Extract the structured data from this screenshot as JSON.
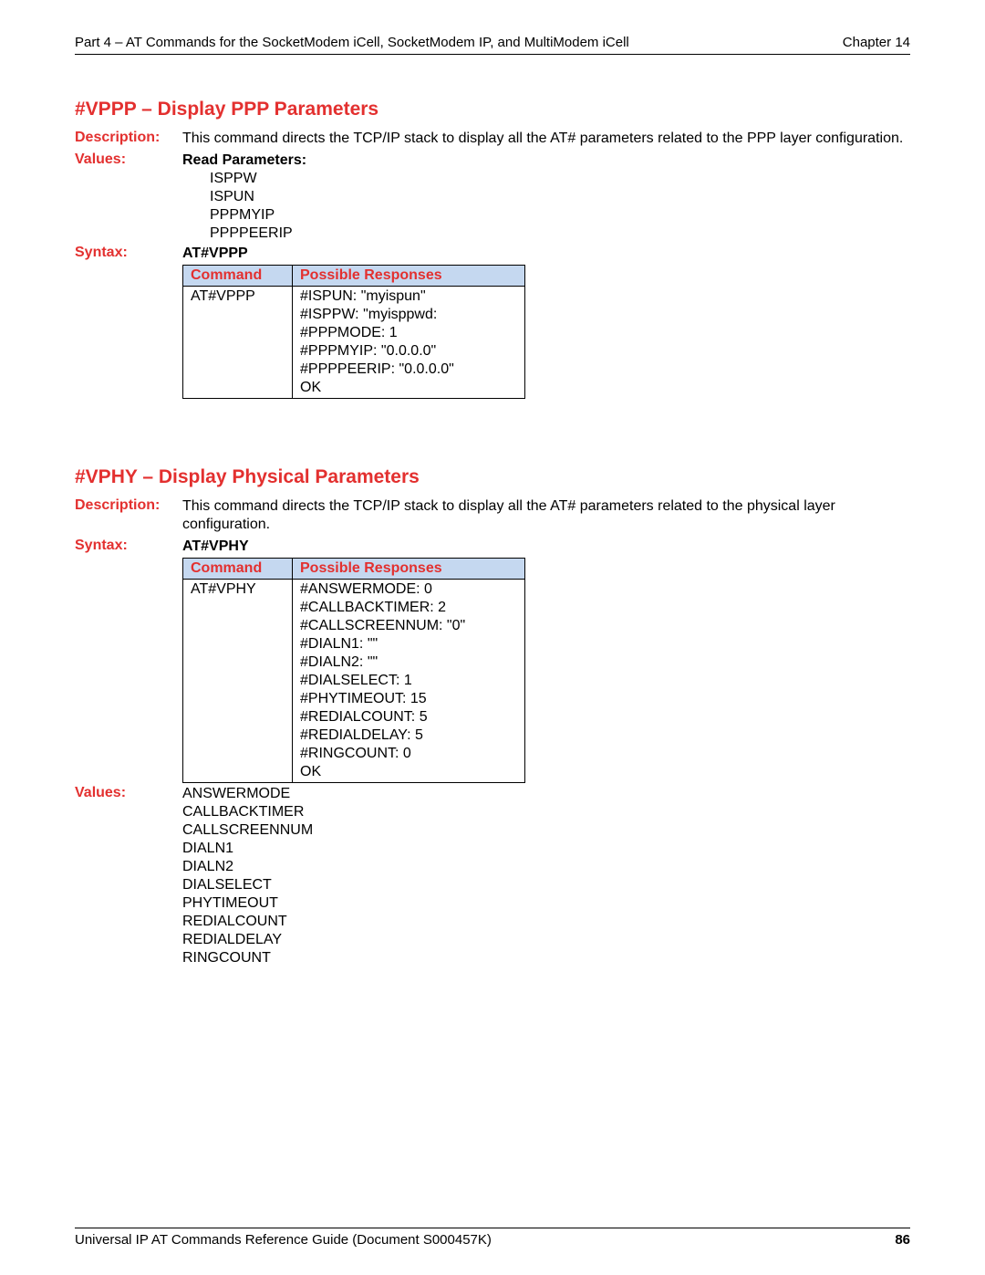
{
  "header": {
    "left": "Part 4 – AT Commands for the SocketModem iCell, SocketModem IP, and MultiModem iCell",
    "right": "Chapter 14"
  },
  "sections": {
    "vppp": {
      "title": "#VPPP – Display PPP Parameters",
      "description_label": "Description:",
      "description": "This command directs the TCP/IP stack to display all the AT# parameters related to the PPP layer configuration.",
      "values_label": "Values:",
      "values_heading": "Read Parameters:",
      "values_items": [
        "ISPPW",
        "ISPUN",
        "PPPMYIP",
        "PPPPEERIP"
      ],
      "syntax_label": "Syntax:",
      "syntax": "AT#VPPP",
      "table": {
        "headers": [
          "Command",
          "Possible Responses"
        ],
        "cmd": "AT#VPPP",
        "responses": [
          "#ISPUN: \"myispun\"",
          "#ISPPW: \"myisppwd:",
          "#PPPMODE: 1",
          "#PPPMYIP: \"0.0.0.0\"",
          "#PPPPEERIP: \"0.0.0.0\"",
          "OK"
        ]
      }
    },
    "vphy": {
      "title": "#VPHY – Display Physical Parameters",
      "description_label": "Description:",
      "description": "This command directs the TCP/IP stack to display all the AT# parameters related to the physical layer configuration.",
      "syntax_label": "Syntax:",
      "syntax": "AT#VPHY",
      "table": {
        "headers": [
          "Command",
          "Possible Responses"
        ],
        "cmd": "AT#VPHY",
        "responses": [
          "#ANSWERMODE: 0",
          "#CALLBACKTIMER: 2",
          "#CALLSCREENNUM: \"0\"",
          "#DIALN1: \"\"",
          "#DIALN2: \"\"",
          "#DIALSELECT: 1",
          "#PHYTIMEOUT: 15",
          "#REDIALCOUNT: 5",
          "#REDIALDELAY: 5",
          "#RINGCOUNT: 0",
          "OK"
        ]
      },
      "values_label": "Values:",
      "values_items": [
        "ANSWERMODE",
        "CALLBACKTIMER",
        "CALLSCREENNUM",
        "DIALN1",
        "DIALN2",
        "DIALSELECT",
        "PHYTIMEOUT",
        "REDIALCOUNT",
        "REDIALDELAY",
        "RINGCOUNT"
      ]
    }
  },
  "footer": {
    "left": "Universal IP AT Commands Reference Guide (Document S000457K)",
    "page": "86"
  }
}
